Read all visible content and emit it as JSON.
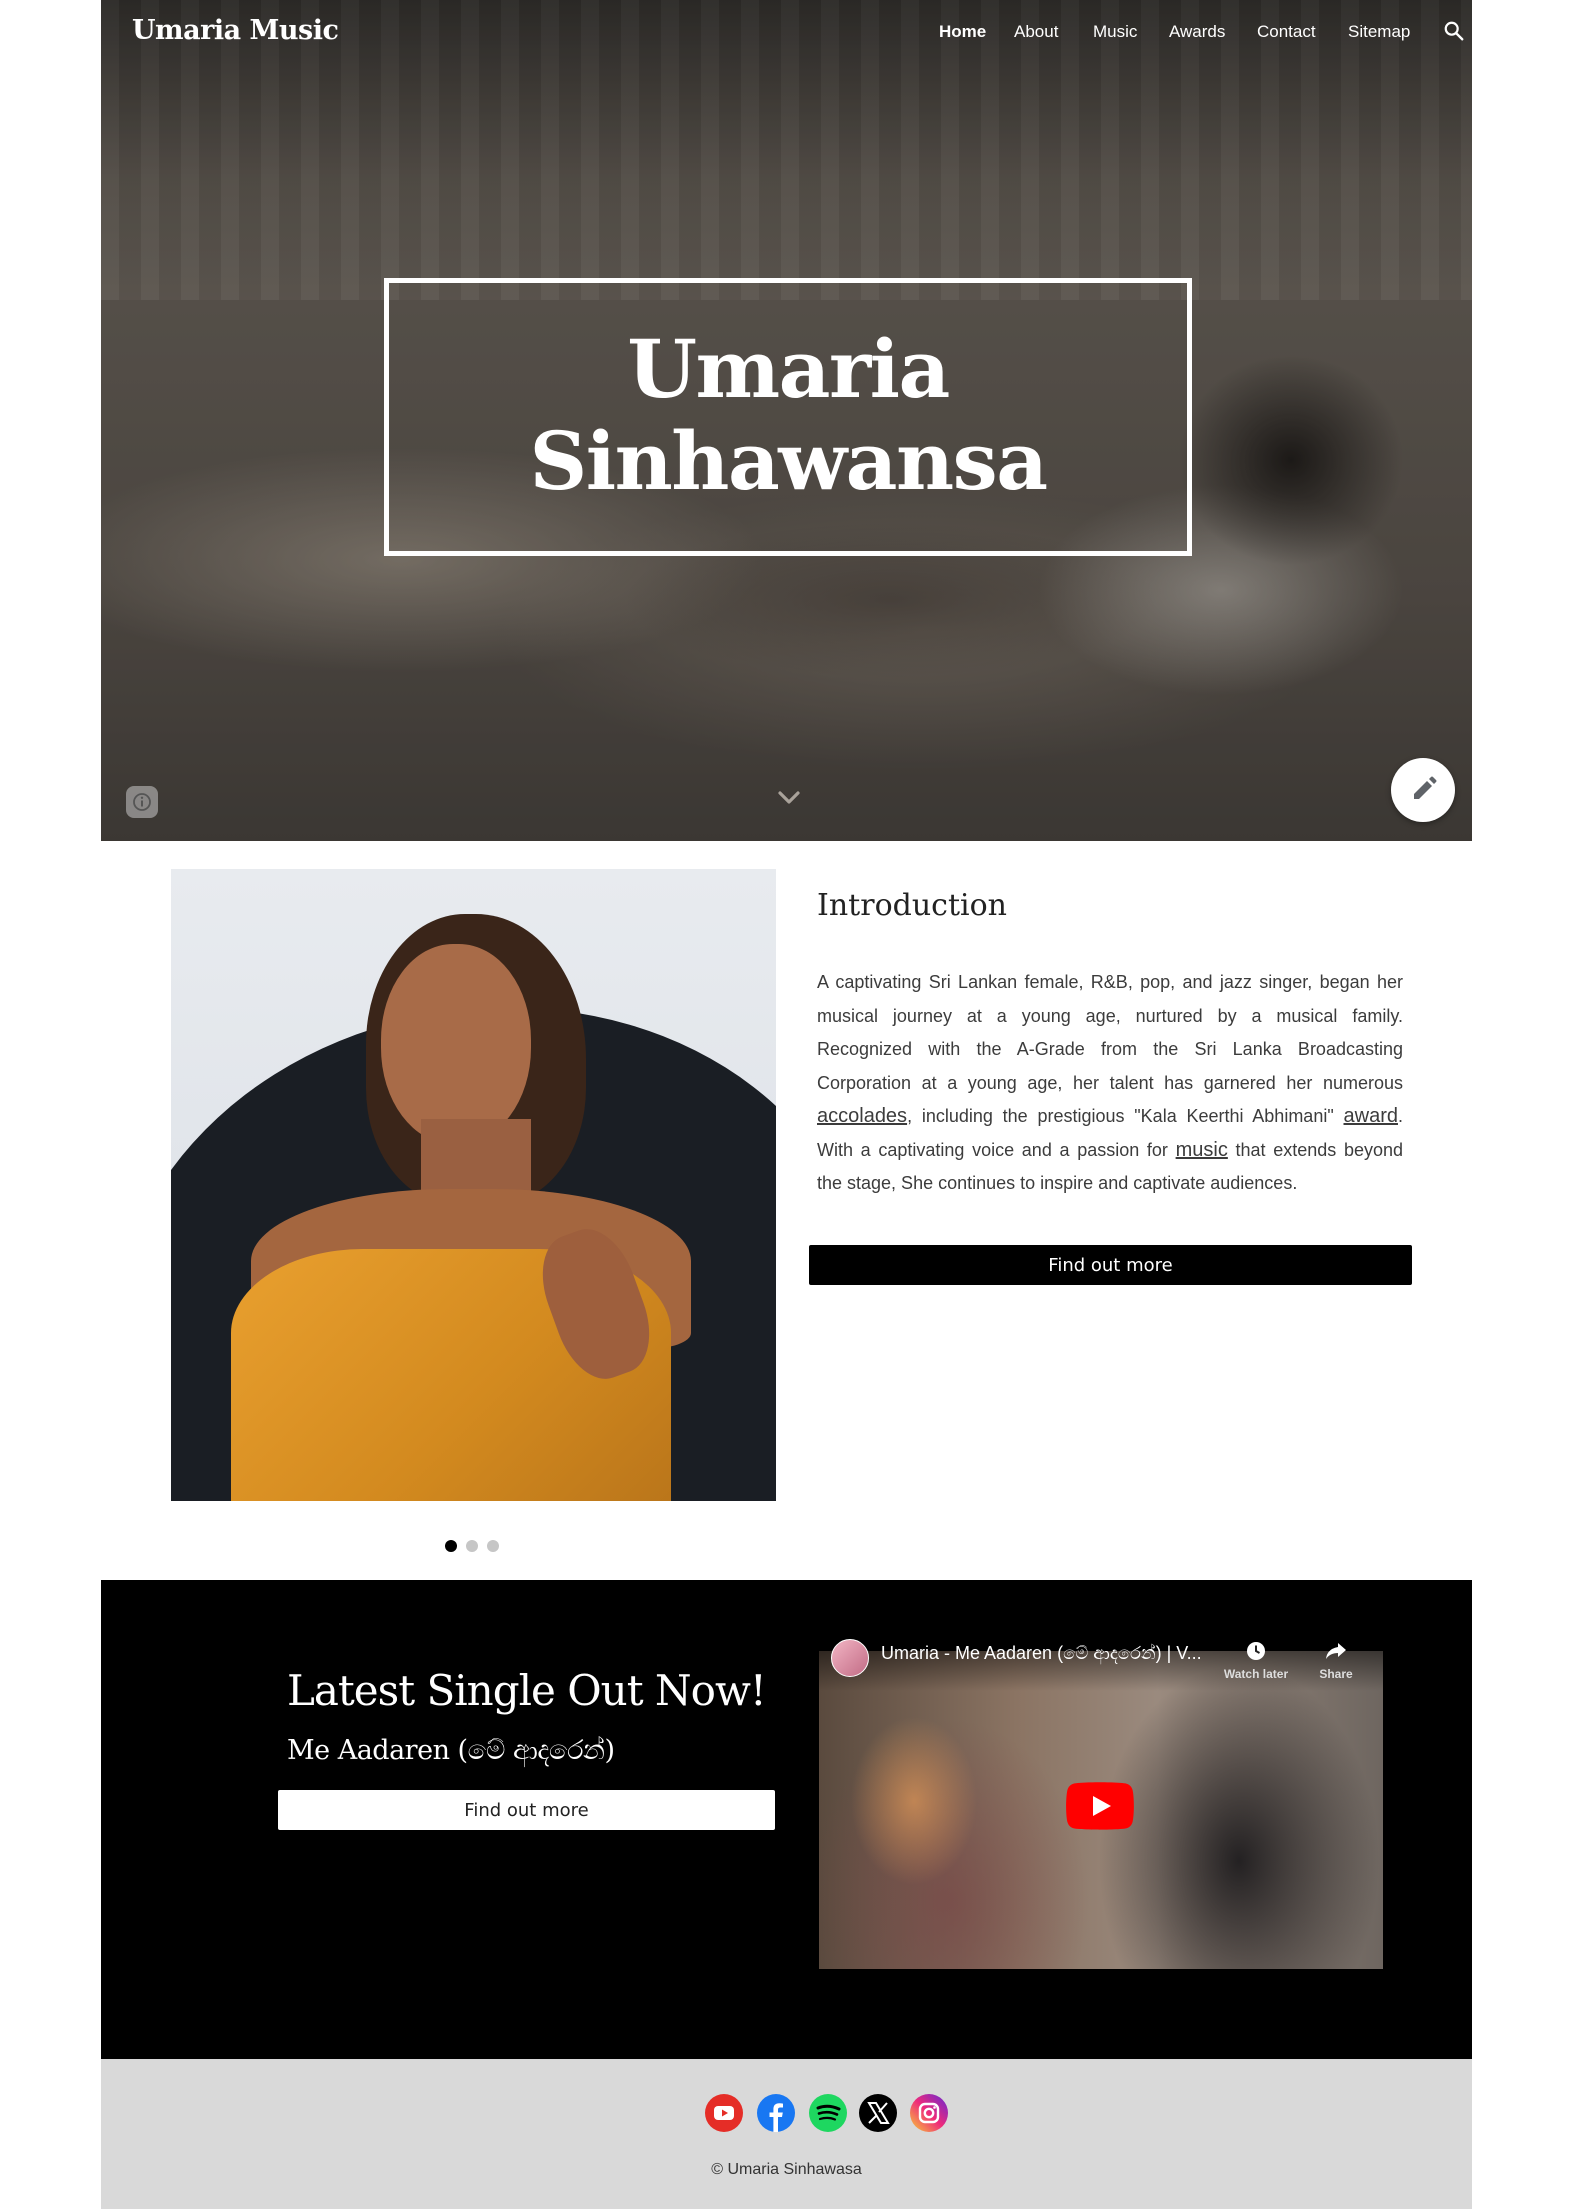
{
  "site": {
    "title": "Umaria Music"
  },
  "nav": {
    "items": [
      {
        "label": "Home",
        "active": true
      },
      {
        "label": "About"
      },
      {
        "label": "Music"
      },
      {
        "label": "Awards"
      },
      {
        "label": "Contact"
      },
      {
        "label": "Sitemap"
      }
    ],
    "search_icon": "search-icon"
  },
  "hero": {
    "title_line1": "Umaria",
    "title_line2": "Sinhawansa",
    "info_icon": "info-icon",
    "scroll_icon": "chevron-down-icon",
    "edit_icon": "pencil-icon"
  },
  "intro": {
    "heading": "Introduction",
    "text_1": "A captivating Sri Lankan female, R&B, pop, and jazz singer, began her musical journey at a young age, nurtured by a musical family. Recognized with the A-Grade from the Sri Lanka Broadcasting Corporation at a young age, her talent has garnered her numerous ",
    "link_accolades": "accolades",
    "text_2": ", including the prestigious \"Kala Keerthi Abhimani\" ",
    "link_award": "award",
    "text_3": ". With a captivating voice and a passion for ",
    "link_music": "music",
    "text_4": " that extends beyond the stage, She continues to inspire and captivate audiences.",
    "button": "Find out more",
    "carousel": {
      "count": 3,
      "active": 0
    }
  },
  "single": {
    "title": "Latest Single Out Now!",
    "subtitle": "Me Aadaren (මේ ආදරෙන්)",
    "button": "Find out more",
    "video": {
      "title": "Umaria - Me Aadaren (මේ ආදරෙන්) | V...",
      "watch_later": "Watch later",
      "share": "Share"
    }
  },
  "footer": {
    "social": [
      {
        "name": "youtube",
        "color": "#e52d27"
      },
      {
        "name": "facebook",
        "color": "#1877f2"
      },
      {
        "name": "spotify",
        "color": "#1ed760"
      },
      {
        "name": "x",
        "color": "#000000"
      },
      {
        "name": "instagram",
        "color": "#e1306c"
      }
    ],
    "copyright": "© Umaria Sinhawasa"
  },
  "colors": {
    "footer_bg": "#d9d9d9",
    "button_dark": "#000000",
    "youtube_red": "#ff0000"
  }
}
